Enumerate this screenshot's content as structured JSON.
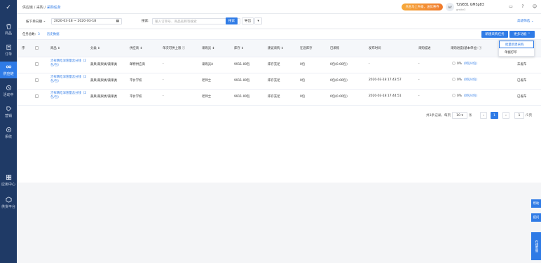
{
  "sidebar": {
    "items": [
      {
        "label": "商品"
      },
      {
        "label": "订单"
      },
      {
        "label": "供应链"
      },
      {
        "label": "活动中"
      },
      {
        "label": "营销"
      },
      {
        "label": "系统"
      },
      {
        "label": "应用中心"
      },
      {
        "label": "供货平台"
      }
    ]
  },
  "topbar": {
    "breadcrumb": [
      "供应链",
      "采购",
      "采购任务"
    ],
    "banner": "点击马上升级，送优惠券",
    "avatar": "AV",
    "user_name": "T29831 GMSp83",
    "user_sub": "gmite3"
  },
  "filters": {
    "date_type": "按下单日期",
    "date_range": "2020-03-18 ~ 2020-03-18",
    "search_label": "搜索:",
    "search_placeholder": "输入订单号、商品名称等搜索",
    "search_btn": "搜索",
    "export_btn": "导出",
    "advanced": "高级筛选"
  },
  "toolbar": {
    "task_count_label": "任务总数：",
    "task_count": "3",
    "history": "历史数据",
    "new_btn": "新建采购任务",
    "more_btn": "更多功能",
    "more_menu": [
      "批量新建采购",
      "单据打印"
    ]
  },
  "table": {
    "headers": [
      "序",
      "商品 ↕",
      "分类 ↕",
      "供应商 ↕",
      "单次可供上限",
      "采购员 ↕",
      "库存 ↕",
      "建议采购 ↕",
      "在途库存",
      "已采购",
      "发布时间",
      "采购描述",
      "采购进度(基本单位)",
      "状态"
    ],
    "rows": [
      {
        "product": "吉祥精吃洋葱量含分钱（2包/包）",
        "category": "蔬果/蔬果类/蔬果类",
        "supplier": "邮特供应商",
        "limit": "-",
        "buyer": "采购员A",
        "stock": "9911.00包",
        "suggest": "库存充足",
        "transit": "0包",
        "purchased": "0包(0.00包)",
        "time": "-",
        "desc": "-",
        "progress": "0%",
        "progress_link": "(0包/4包)",
        "status": "未发布"
      },
      {
        "product": "吉祥精吃洋葱量含分钱（2包/包）",
        "category": "蔬果/蔬果类/蔬果类",
        "supplier": "平价学校",
        "limit": "-",
        "buyer": "老师士",
        "stock": "9911.00包",
        "suggest": "库存充足",
        "transit": "0包",
        "purchased": "0包(0.00包)",
        "time": "2020-03-18 17:43:57",
        "desc": "-",
        "progress": "0%",
        "progress_link": "(0包/4包)",
        "status": "已发布"
      },
      {
        "product": "吉祥精吃洋葱量含分钱（2包/包）",
        "category": "蔬果/蔬果类/蔬果类",
        "supplier": "平价学校",
        "limit": "-",
        "buyer": "老师士",
        "stock": "9911.00包",
        "suggest": "库存充足",
        "transit": "0包",
        "purchased": "0包(0.00包)",
        "time": "2020-03-18 17:44:51",
        "desc": "-",
        "progress": "0%",
        "progress_link": "(0包/4包)",
        "status": "已发布"
      }
    ]
  },
  "pagination": {
    "summary": "共3条记录，每页",
    "page_size": "10",
    "unit": "条",
    "current_page": "1",
    "jump_value": "1",
    "total_pages": "/1页"
  },
  "floats": [
    "帮助",
    "提问",
    "在线客服"
  ]
}
